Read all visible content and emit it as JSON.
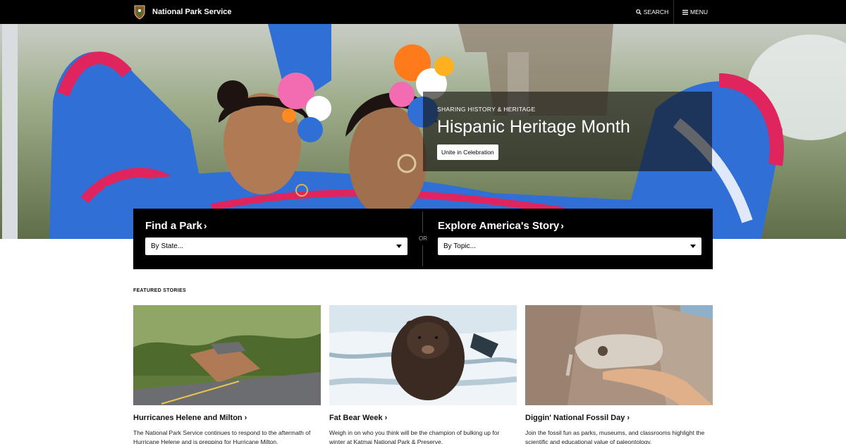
{
  "site": {
    "brand_name": "National Park Service",
    "search_label": "SEARCH",
    "menu_label": "MENU"
  },
  "hero": {
    "kicker": "SHARING HISTORY & HERITAGE",
    "title": "Hispanic Heritage Month",
    "cta_label": "Unite in Celebration"
  },
  "finder": {
    "park_heading": "Find a Park",
    "park_select_value": "By State...",
    "or_label": "OR",
    "story_heading": "Explore America's Story",
    "story_select_value": "By Topic..."
  },
  "featured": {
    "label": "FEATURED STORIES",
    "cards": [
      {
        "title": "Hurricanes Helene and Milton",
        "description": "The National Park Service continues to respond to the aftermath of Hurricane Helene and is prepping for Hurricane Milton."
      },
      {
        "title": "Fat Bear Week",
        "description": "Weigh in on who you think will be the champion of bulking up for winter at Katmai National Park & Preserve."
      },
      {
        "title": "Diggin' National Fossil Day",
        "description": "Join the fossil fun as parks, museums, and classrooms highlight the scientific and educational value of paleontology."
      }
    ]
  },
  "colors": {
    "topbar": "#000000",
    "panel": "#000000",
    "dress_blue": "#2f6fd6",
    "dress_red": "#e0245e"
  }
}
